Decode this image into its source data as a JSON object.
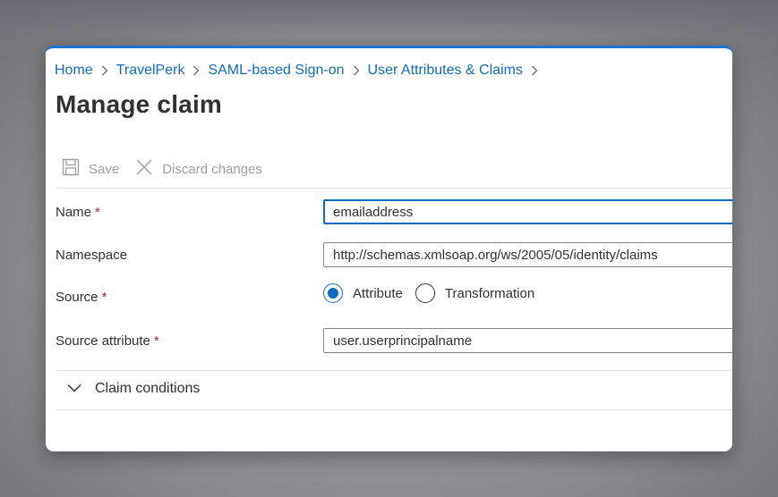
{
  "breadcrumb": [
    "Home",
    "TravelPerk",
    "SAML-based Sign-on",
    "User Attributes & Claims"
  ],
  "page_title": "Manage claim",
  "toolbar": {
    "save_label": "Save",
    "discard_label": "Discard changes"
  },
  "form": {
    "name": {
      "label": "Name",
      "required_mark": "*",
      "value": "emailaddress"
    },
    "namespace": {
      "label": "Namespace",
      "value": "http://schemas.xmlsoap.org/ws/2005/05/identity/claims"
    },
    "source": {
      "label": "Source",
      "required_mark": "*",
      "options": [
        {
          "label": "Attribute",
          "selected": true
        },
        {
          "label": "Transformation",
          "selected": false
        }
      ]
    },
    "source_attribute": {
      "label": "Source attribute",
      "required_mark": "*",
      "value": "user.userprincipalname"
    }
  },
  "claim_conditions": {
    "label": "Claim conditions",
    "expanded": false
  },
  "colors": {
    "accent": "#0f6cbd",
    "required": "#a4262c",
    "disabled": "#a19f9d",
    "text": "#323130"
  },
  "icons": {
    "save": "save-icon",
    "discard": "close-icon",
    "expand": "chevron-down-icon",
    "separator": "chevron-right-icon"
  }
}
